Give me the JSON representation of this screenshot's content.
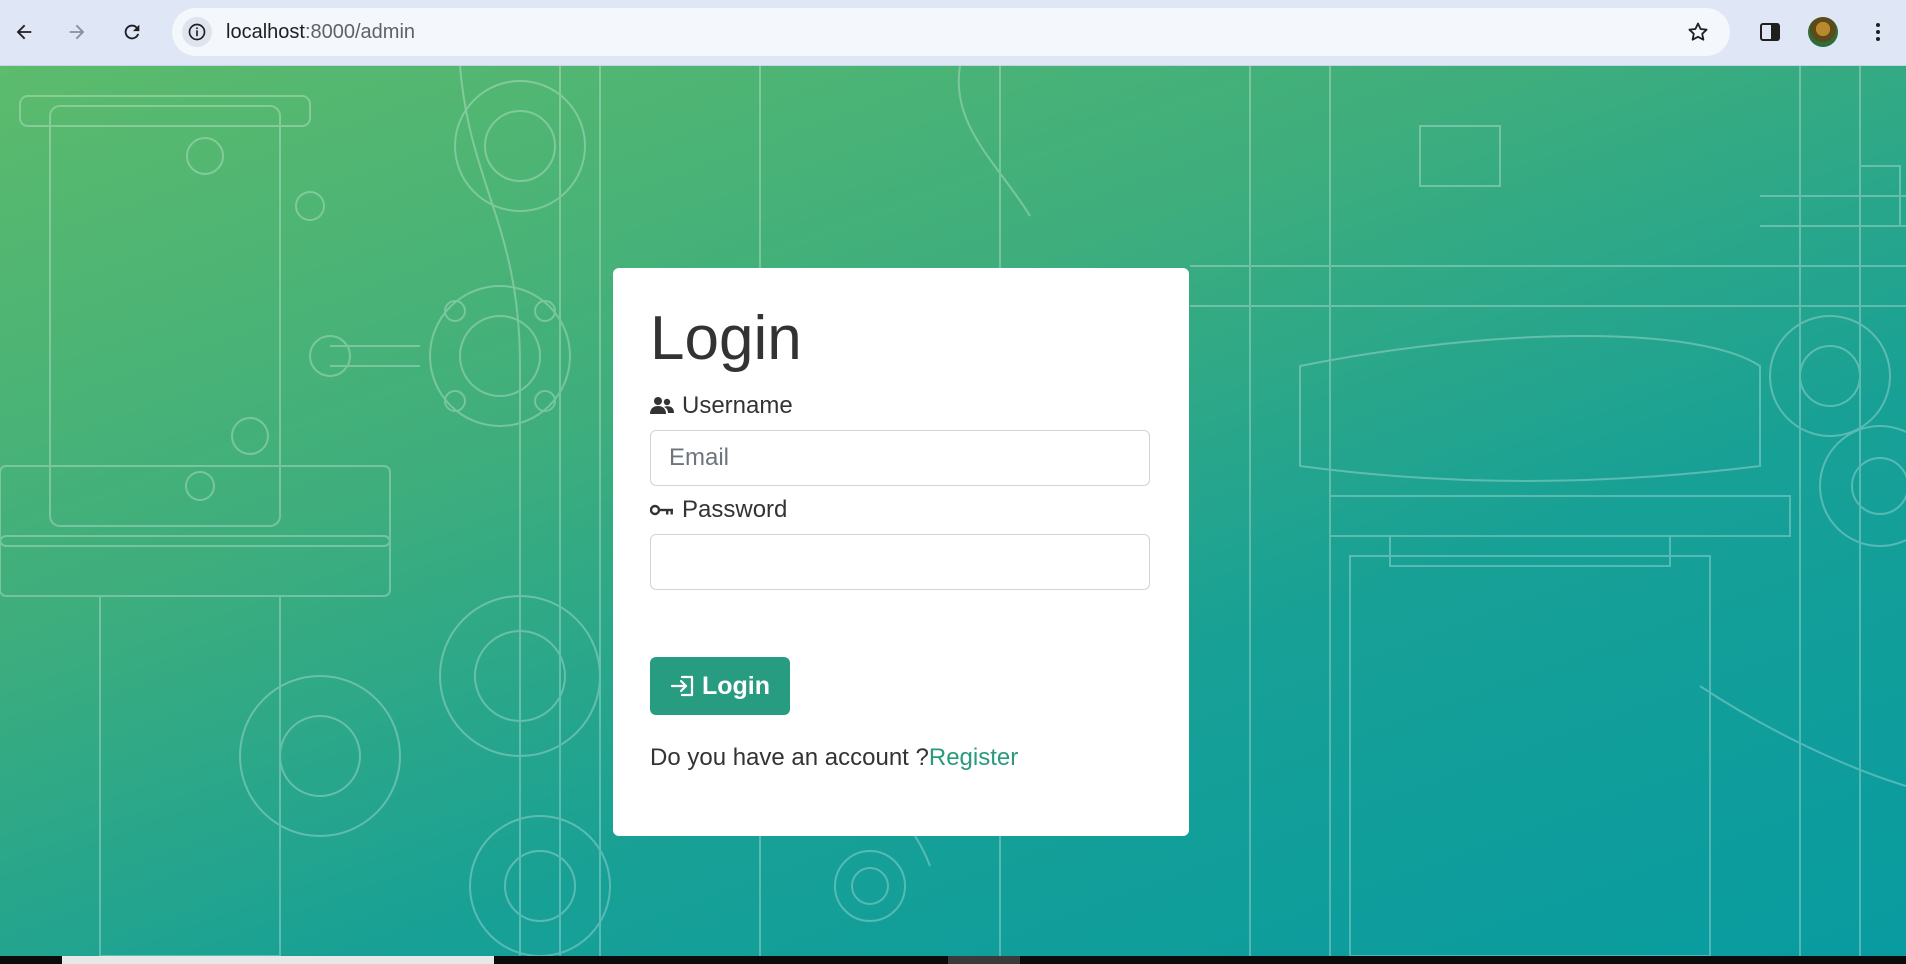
{
  "browser": {
    "url_host": "localhost",
    "url_path": ":8000/admin"
  },
  "login_form": {
    "title": "Login",
    "username_label": "Username",
    "username_placeholder": "Email",
    "username_value": "",
    "password_label": "Password",
    "password_value": "",
    "submit_label": "Login",
    "register_prompt": "Do you have an account ?",
    "register_link": "Register"
  },
  "icons": {
    "back": "arrow-left-icon",
    "forward": "arrow-right-icon",
    "reload": "reload-icon",
    "site_info": "info-icon",
    "bookmark": "star-icon",
    "side_panel": "side-panel-icon",
    "menu": "kebab-menu-icon",
    "username": "users-icon",
    "password": "key-icon",
    "submit": "login-icon"
  },
  "colors": {
    "accent": "#279c81",
    "link": "#2a9a7d",
    "gradient_start": "#5cbb6c",
    "gradient_end": "#089ba0"
  }
}
